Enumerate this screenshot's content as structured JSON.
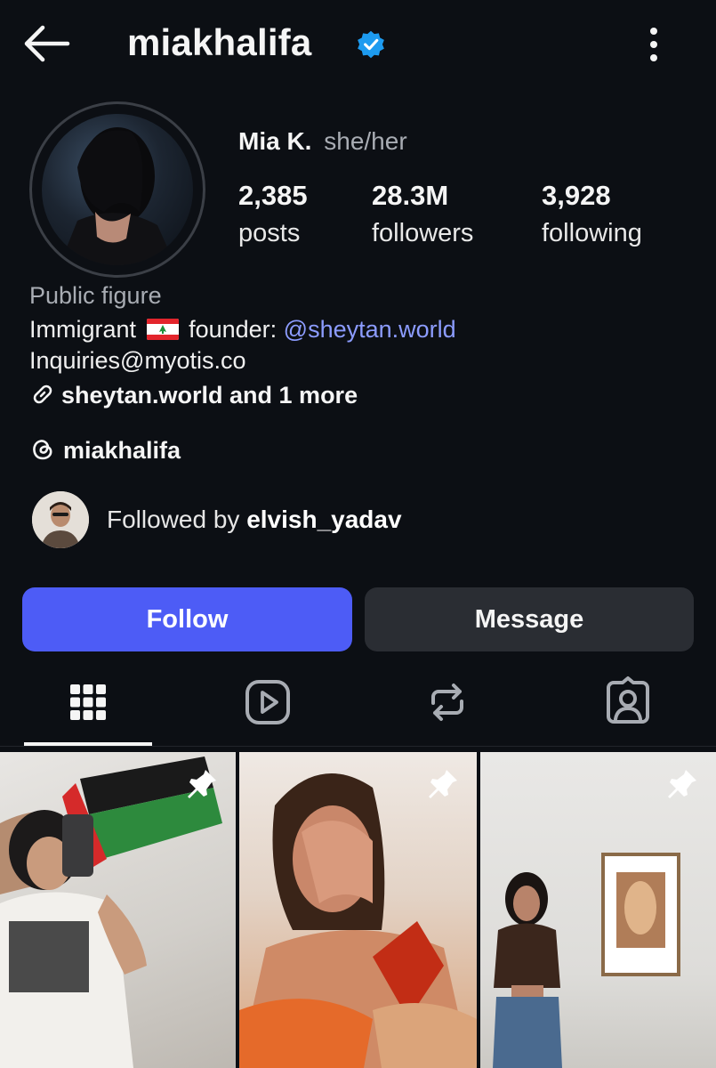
{
  "header": {
    "back_icon": "arrow-left-icon",
    "username": "miakhalifa",
    "verified_icon": "verified-badge-icon",
    "more_icon": "more-vertical-icon"
  },
  "profile": {
    "name": "Mia K.",
    "pronouns": "she/her",
    "stats": [
      {
        "value": "2,385",
        "label": "posts"
      },
      {
        "value": "28.3M",
        "label": "followers"
      },
      {
        "value": "3,928",
        "label": "following"
      }
    ],
    "category": "Public figure",
    "bio_line1_prefix": "Immigrant",
    "bio_line1_middle": "founder:",
    "bio_mention": "@sheytan.world",
    "bio_line2": "Inquiries@myotis.co",
    "links_label": "sheytan.world and 1 more",
    "threads_handle": "miakhalifa"
  },
  "followed_by": {
    "prefix": "Followed by",
    "user": "elvish_yadav"
  },
  "actions": {
    "follow_label": "Follow",
    "message_label": "Message"
  },
  "tabs": [
    {
      "icon": "grid-icon",
      "active": true
    },
    {
      "icon": "reels-icon",
      "active": false
    },
    {
      "icon": "reposts-icon",
      "active": false
    },
    {
      "icon": "tagged-icon",
      "active": false
    }
  ],
  "colors": {
    "background": "#0c0f14",
    "follow_button": "#4d5cf6",
    "message_button": "#2a2d33",
    "mention": "#8c9cff",
    "verified": "#1d9bf0"
  }
}
